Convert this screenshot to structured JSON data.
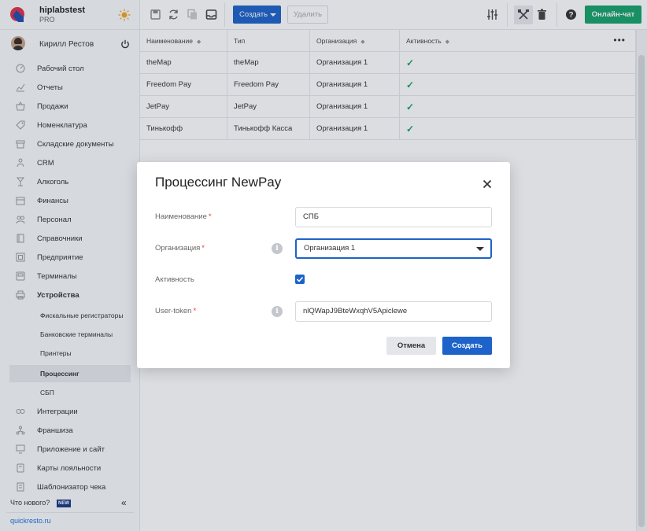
{
  "brand": {
    "name": "hiplabstest",
    "plan": "PRO",
    "colors": {
      "logo_red": "#e0324a",
      "logo_blue": "#1e4fb0",
      "sun": "#f2a623"
    }
  },
  "user": {
    "name": "Кирилл Рестов"
  },
  "sidebar": {
    "items": [
      {
        "label": "Рабочий стол",
        "icon": "dashboard-icon"
      },
      {
        "label": "Отчеты",
        "icon": "chart-icon"
      },
      {
        "label": "Продажи",
        "icon": "basket-icon"
      },
      {
        "label": "Номенклатура",
        "icon": "tag-icon"
      },
      {
        "label": "Складские документы",
        "icon": "box-icon"
      },
      {
        "label": "CRM",
        "icon": "users-icon"
      },
      {
        "label": "Алкоголь",
        "icon": "glass-icon"
      },
      {
        "label": "Финансы",
        "icon": "wallet-icon"
      },
      {
        "label": "Персонал",
        "icon": "people-icon"
      },
      {
        "label": "Справочники",
        "icon": "book-icon"
      },
      {
        "label": "Предприятие",
        "icon": "building-icon"
      },
      {
        "label": "Терминалы",
        "icon": "terminal-icon"
      },
      {
        "label": "Устройства",
        "icon": "printer-icon"
      },
      {
        "label": "Фискальные регистраторы",
        "icon": ""
      },
      {
        "label": "Банковские терминалы",
        "icon": ""
      },
      {
        "label": "Принтеры",
        "icon": ""
      },
      {
        "label": "Процессинг",
        "icon": ""
      },
      {
        "label": "СБП",
        "icon": ""
      },
      {
        "label": "Интеграции",
        "icon": "link-icon"
      },
      {
        "label": "Франшиза",
        "icon": "network-icon"
      },
      {
        "label": "Приложение и сайт",
        "icon": "monitor-icon"
      },
      {
        "label": "Карты лояльности",
        "icon": "card-icon"
      },
      {
        "label": "Шаблонизатор чека",
        "icon": "receipt-icon"
      }
    ],
    "whats_new": "Что нового?",
    "new_badge": "NEW",
    "collapse": "«",
    "site": "quickresto.ru"
  },
  "toolbar": {
    "create_label": "Создать",
    "delete_label": "Удалить",
    "chat_label": "Онлайн-чат",
    "accent": "#1e63c9",
    "chat_color": "#18a36a"
  },
  "table": {
    "columns": [
      "Наименование",
      "Тип",
      "Организация",
      "Активность"
    ],
    "rows": [
      {
        "name": "theMap",
        "type": "theMap",
        "org": "Организация 1",
        "active": true
      },
      {
        "name": "Freedom Pay",
        "type": "Freedom Pay",
        "org": "Организация 1",
        "active": true
      },
      {
        "name": "JetPay",
        "type": "JetPay",
        "org": "Организация 1",
        "active": true
      },
      {
        "name": "Тинькофф",
        "type": "Тинькофф Касса",
        "org": "Организация 1",
        "active": true
      }
    ]
  },
  "modal": {
    "title": "Процессинг NewPay",
    "fields": {
      "name_label": "Наименование",
      "name_value": "СПБ",
      "org_label": "Организация",
      "org_value": "Организация 1",
      "active_label": "Активность",
      "active_checked": true,
      "token_label": "User-token",
      "token_value": "nlQWapJ9BteWxqhV5Apiclewe"
    },
    "required_mark": "*",
    "cancel_label": "Отмена",
    "submit_label": "Создать"
  }
}
